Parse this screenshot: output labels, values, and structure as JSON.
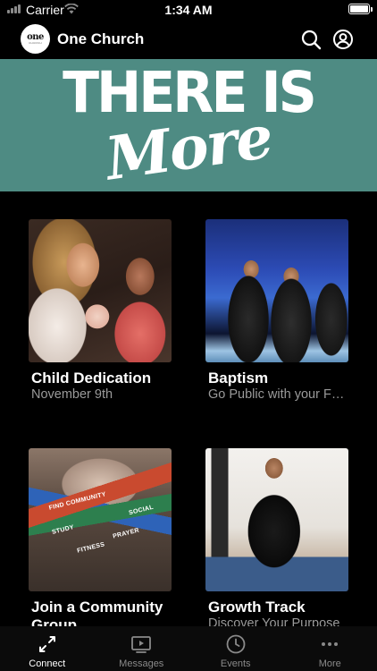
{
  "status_bar": {
    "carrier": "Carrier",
    "time": "1:34 AM"
  },
  "header": {
    "logo_text": "one",
    "logo_subtext": "CHURCH",
    "title": "One Church"
  },
  "banner": {
    "line1": "THERE IS",
    "line2": "More",
    "background": "#4e8b83"
  },
  "cards": [
    {
      "title": "Child Dedication",
      "subtitle": "November 9th"
    },
    {
      "title": "Baptism",
      "subtitle": "Go Public with your Faith"
    },
    {
      "title": "Join a Community Group",
      "subtitle": ""
    },
    {
      "title": "Growth Track",
      "subtitle": "Discover Your Purpose"
    }
  ],
  "card_image_tags": {
    "find_community": "FIND COMMUNITY",
    "social": "SOCIAL",
    "study": "STUDY",
    "prayer": "PRAYER",
    "fitness": "FITNESS"
  },
  "tab_bar": {
    "active_index": 0,
    "tabs": [
      {
        "label": "Connect",
        "icon": "connect-icon"
      },
      {
        "label": "Messages",
        "icon": "play-video-icon"
      },
      {
        "label": "Events",
        "icon": "clock-icon"
      },
      {
        "label": "More",
        "icon": "more-dots-icon"
      }
    ]
  }
}
